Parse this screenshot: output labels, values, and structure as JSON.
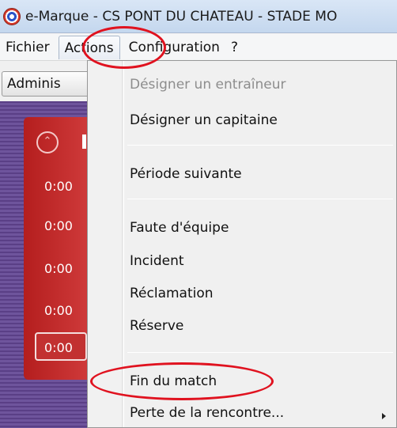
{
  "window": {
    "title": "e-Marque - CS PONT DU CHATEAU  - STADE MO",
    "app_icon": "emarque-logo-icon"
  },
  "menubar": {
    "items": [
      "Fichier",
      "Actions",
      "Configuration",
      "?"
    ],
    "active": "Actions"
  },
  "background_app": {
    "toolbar_button": "Adminis",
    "times": [
      "0:00",
      "0:00",
      "0:00",
      "0:00",
      "0:00"
    ],
    "colors": {
      "panel": "#5a3f86",
      "card": "#c02828"
    }
  },
  "dropdown": {
    "items": [
      {
        "label": "Désigner un entraîneur",
        "enabled": false
      },
      {
        "label": "Désigner un capitaine",
        "enabled": true
      },
      {
        "label": "Période suivante",
        "enabled": true
      },
      {
        "label": "Faute d'équipe",
        "enabled": true
      },
      {
        "label": "Incident",
        "enabled": true
      },
      {
        "label": "Réclamation",
        "enabled": true
      },
      {
        "label": "Réserve",
        "enabled": true
      },
      {
        "label": "Fin du match",
        "enabled": true
      },
      {
        "label": "Perte de la rencontre...",
        "enabled": true,
        "submenu": true
      }
    ]
  },
  "annotations": {
    "highlight_color": "#e0121f"
  }
}
